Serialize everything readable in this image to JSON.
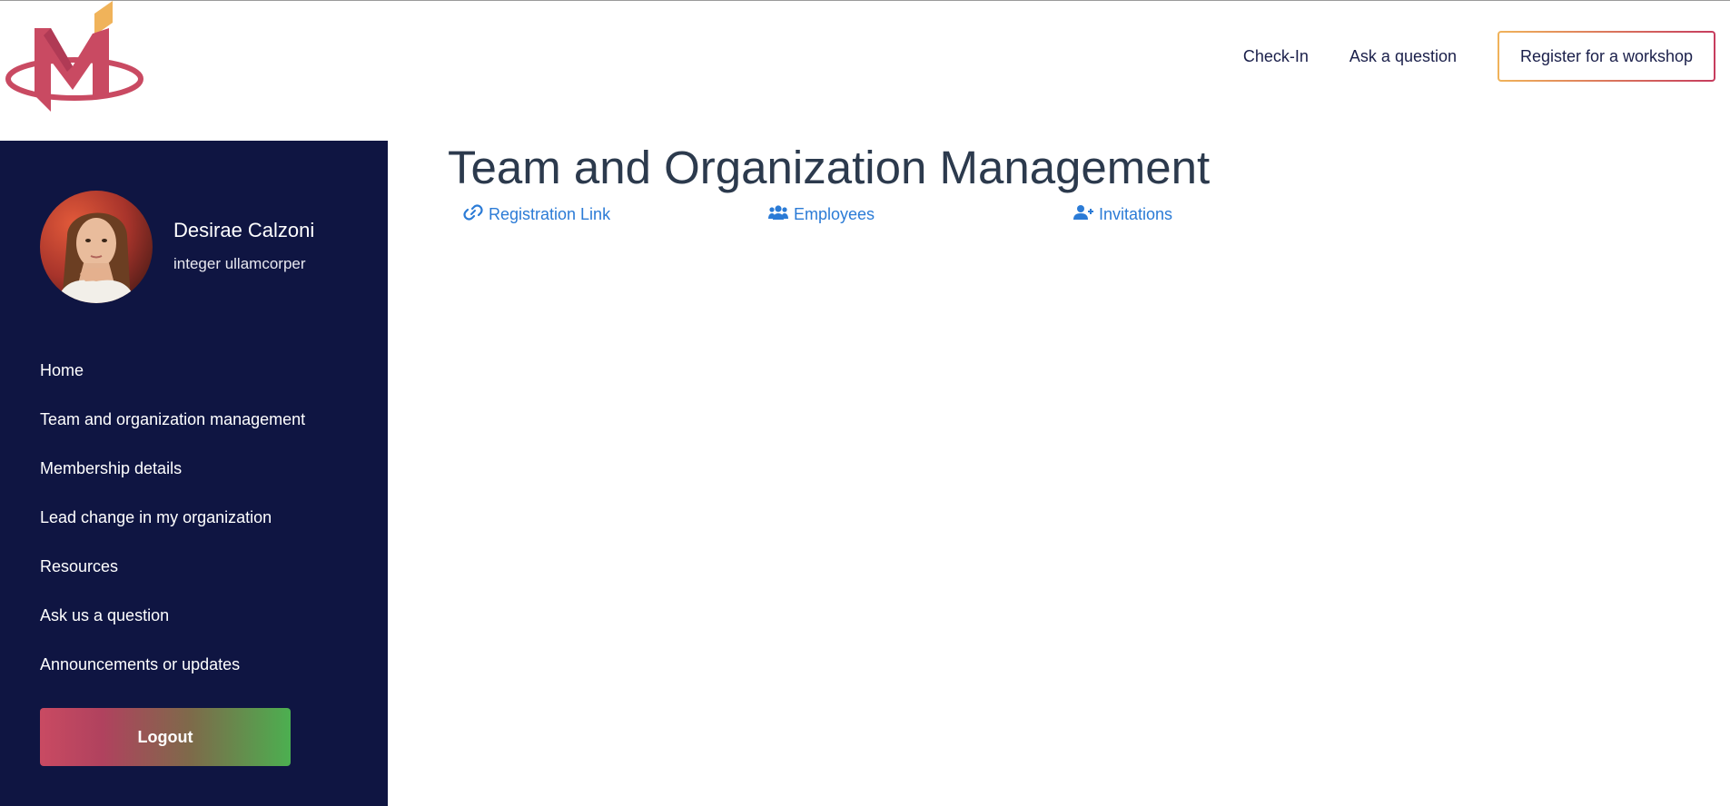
{
  "header": {
    "logo_icon": "m-logo-icon",
    "nav": {
      "checkin_label": "Check-In",
      "ask_label": "Ask a question",
      "register_label": "Register for a workshop"
    },
    "colors": {
      "brand_red": "#c94a62",
      "brand_gold": "#f0b35a",
      "nav_text": "#1a1f4a"
    }
  },
  "sidebar": {
    "background": "#0f1542",
    "profile": {
      "name": "Desirae Calzoni",
      "subtitle": "integer ullamcorper",
      "avatar_icon": "user-avatar"
    },
    "menu": [
      {
        "label": "Home"
      },
      {
        "label": "Team and organization management"
      },
      {
        "label": "Membership details"
      },
      {
        "label": "Lead change in my organization"
      },
      {
        "label": "Resources"
      },
      {
        "label": "Ask us a question"
      },
      {
        "label": "Announcements or updates"
      }
    ],
    "logout_label": "Logout"
  },
  "main": {
    "title": "Team and Organization Management",
    "tabs": [
      {
        "label": "Registration Link",
        "icon": "link-icon"
      },
      {
        "label": "Employees",
        "icon": "users-icon"
      },
      {
        "label": "Invitations",
        "icon": "user-plus-icon"
      }
    ],
    "link_color": "#2b7bd6",
    "title_color": "#2c3a4d"
  }
}
